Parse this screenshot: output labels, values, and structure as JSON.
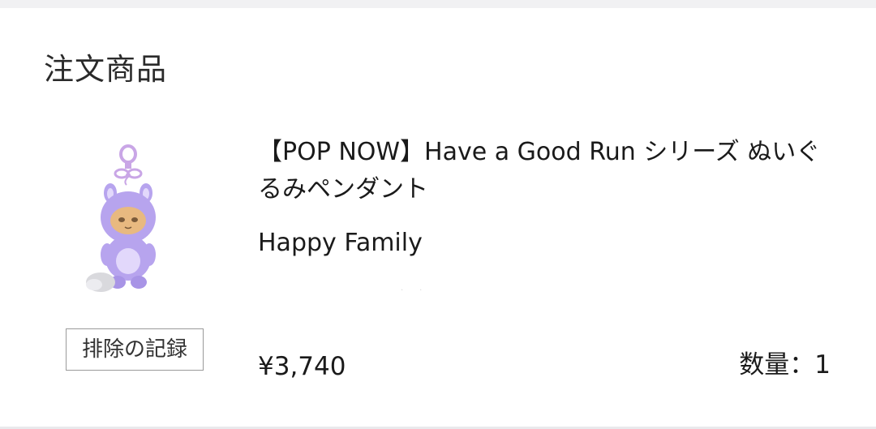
{
  "section": {
    "title": "注文商品"
  },
  "item": {
    "name": "【POP NOW】Have a Good Run シリーズ ぬいぐるみペンダント",
    "variant": "Happy Family",
    "price": "¥3,740",
    "quantity_label": "数量",
    "quantity_separator": "：",
    "quantity_value": "1",
    "action_label": "排除の記録",
    "image_icon": "plush-keychain-icon"
  },
  "colors": {
    "plush_main": "#b7a4ee",
    "plush_light": "#e2d8fb",
    "face": "#e8b980",
    "ring": "#c9a6e6",
    "tail": "#d9d9dd"
  }
}
